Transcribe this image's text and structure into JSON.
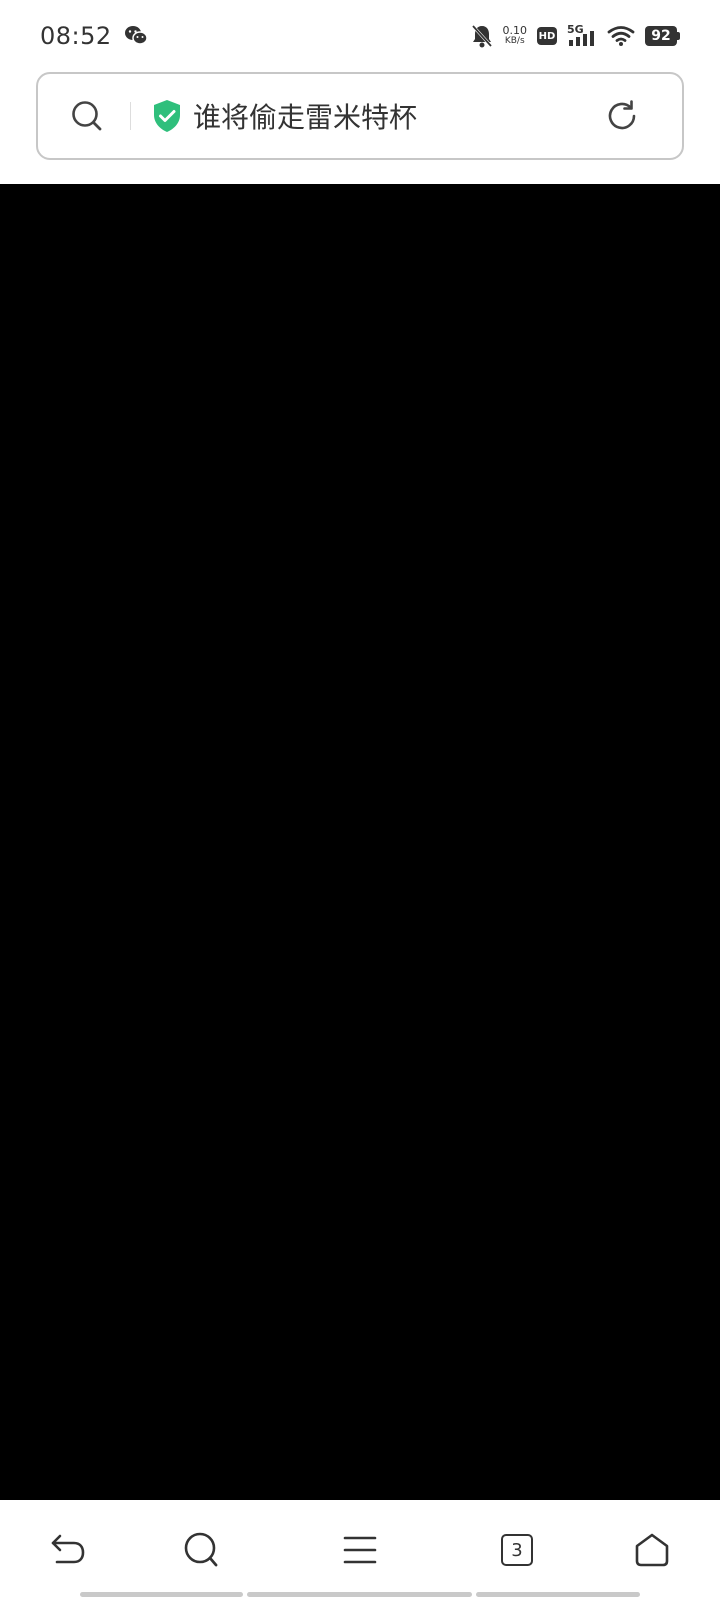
{
  "status_bar": {
    "time": "08:52",
    "net_speed_value": "0.10",
    "net_speed_unit": "KB/s",
    "hd_label": "HD",
    "network_type": "5G",
    "battery_level": "92"
  },
  "url_bar": {
    "title": "谁将偷走雷米特杯"
  },
  "tabs": {
    "count": "3"
  },
  "colors": {
    "shield": "#2fbf7c",
    "content_bg": "#000000"
  }
}
